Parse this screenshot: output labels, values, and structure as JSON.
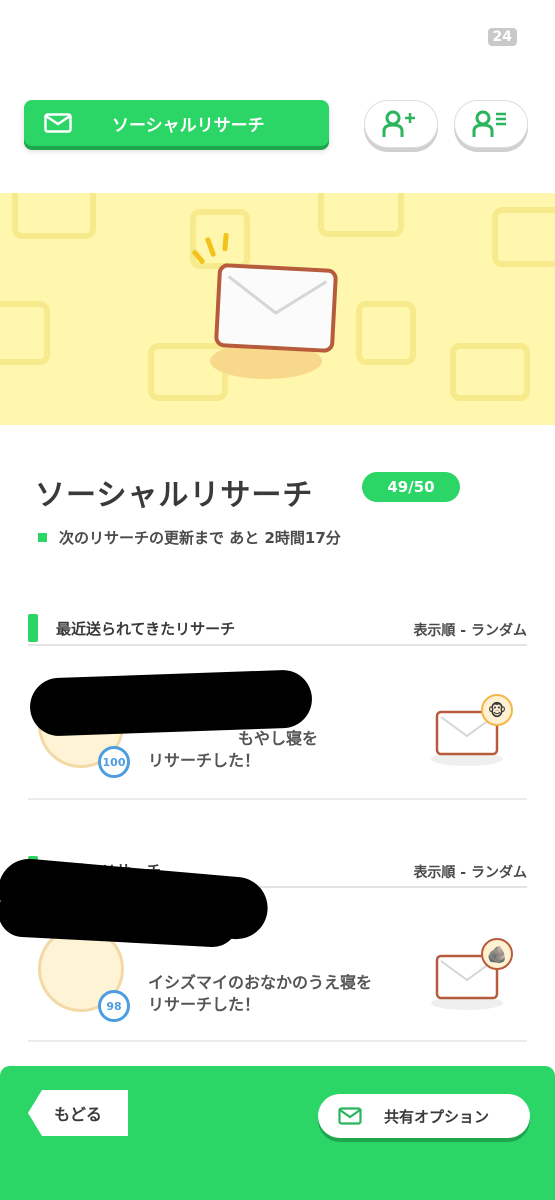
{
  "status": {
    "badge": "24"
  },
  "header": {
    "title": "ソーシャルリサーチ"
  },
  "main": {
    "title": "ソーシャルリサーチ",
    "count": "49/50",
    "refresh_text": "次のリサーチの更新まで あと 2時間17分"
  },
  "recent": {
    "title": "最近送られてきたリサーチ",
    "order": "表示順 - ランダム",
    "item": {
      "level": "100",
      "line1": "もやし寝を",
      "line2": "リサーチした！"
    }
  },
  "previous": {
    "title": "以前のリサーチ",
    "order": "表示順 - ランダム",
    "item": {
      "level": "98",
      "line1": "イシズマイのおなかのうえ寝を",
      "line2": "リサーチした！"
    }
  },
  "footer": {
    "back_label": "もどる",
    "share_label": "共有オプション"
  },
  "colors": {
    "accent": "#2bd566",
    "banner": "#fff7ad",
    "level": "#4d9de0"
  }
}
